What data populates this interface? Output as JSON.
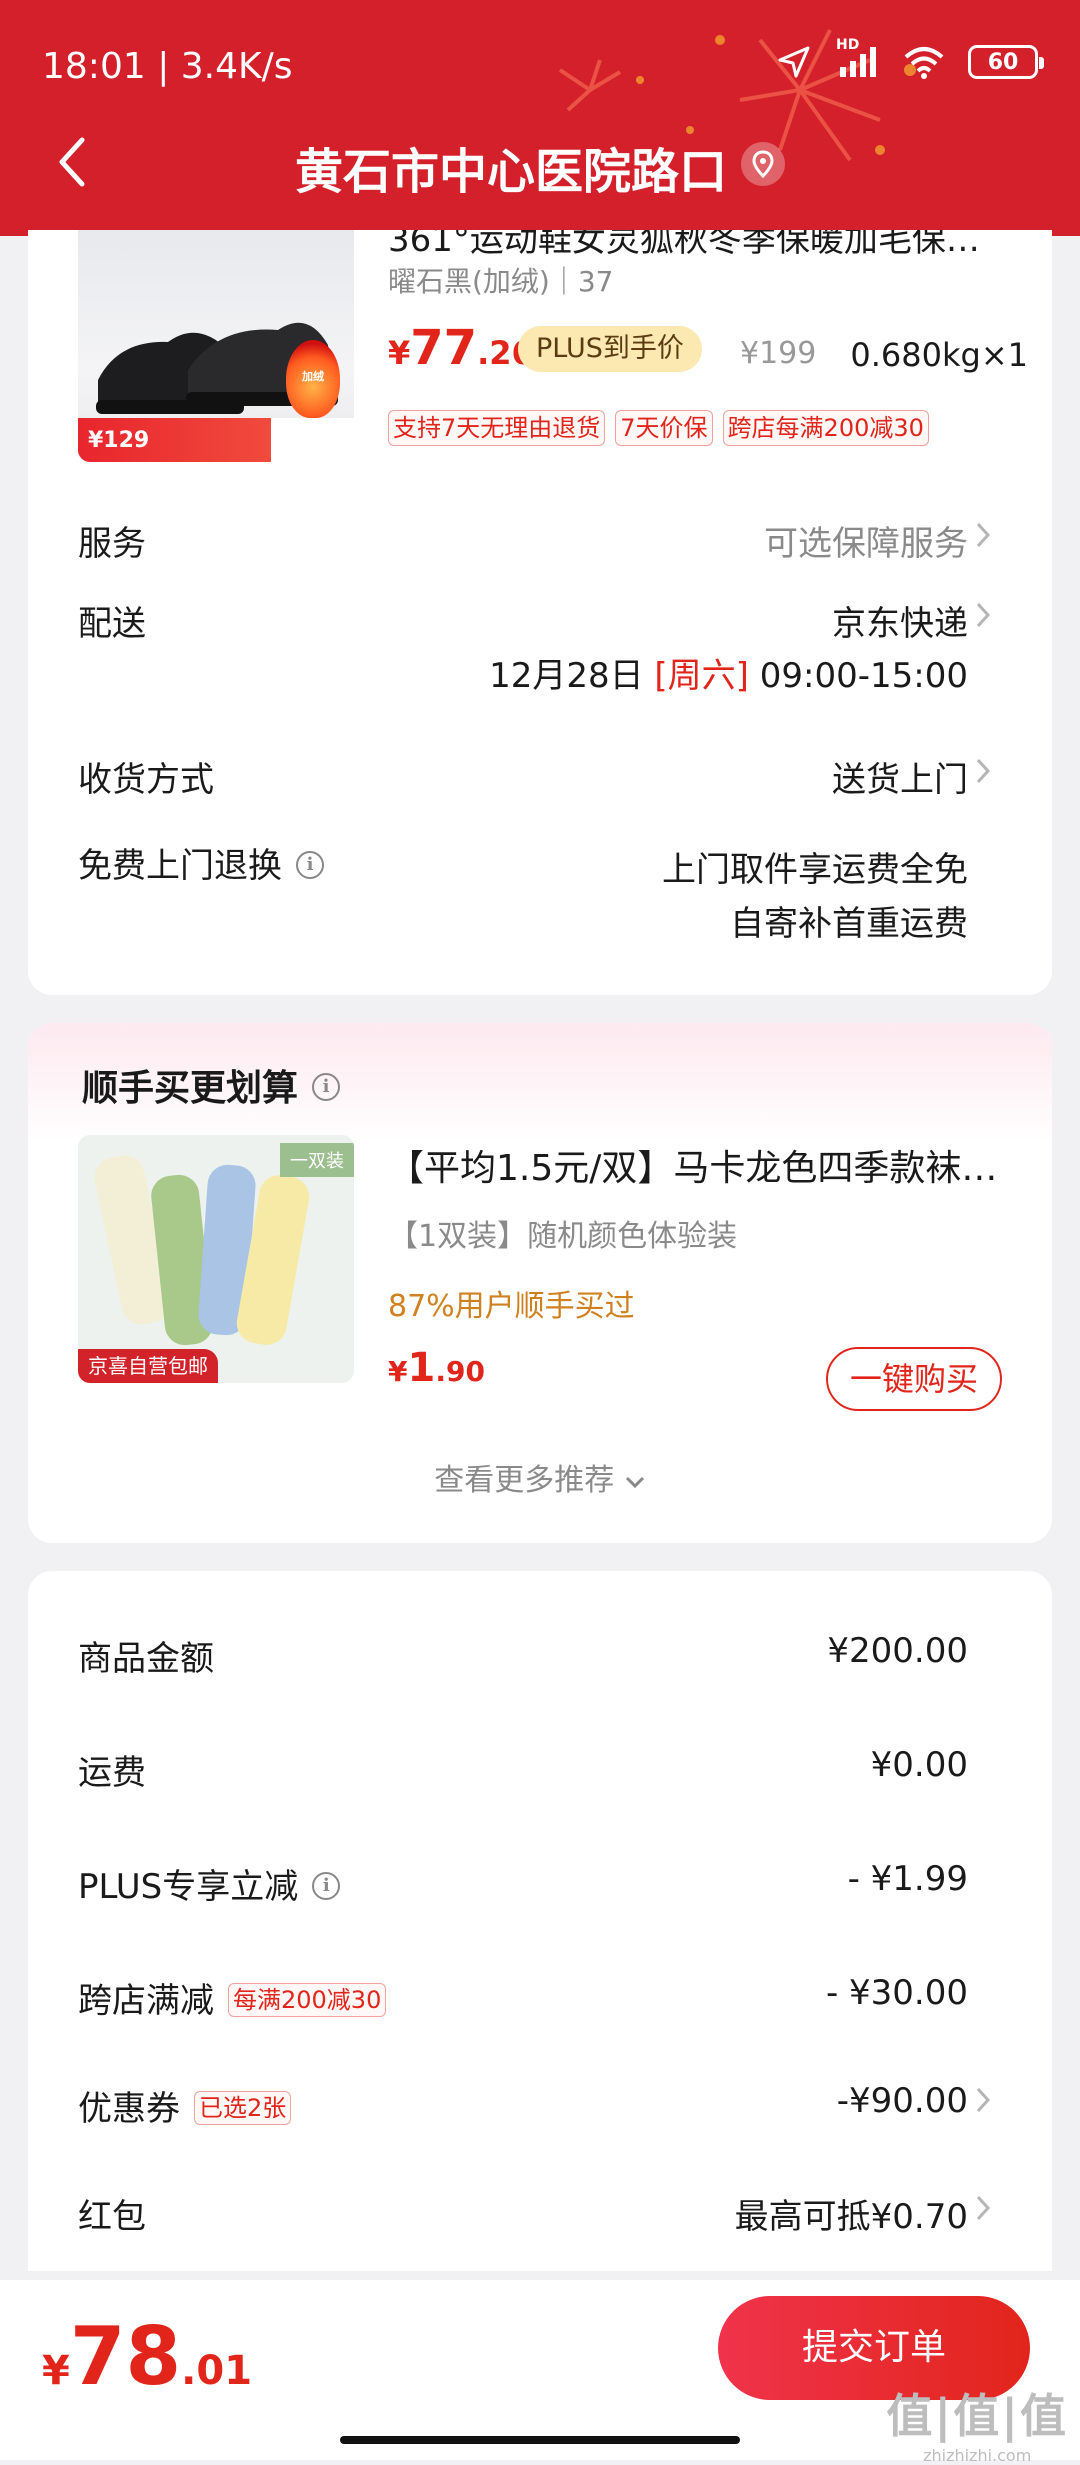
{
  "status_bar": {
    "time": "18:01 | 3.4K/s",
    "network": "HD",
    "battery": "60"
  },
  "header": {
    "title": "黄石市中心医院路口",
    "bg_color": "#d3202a"
  },
  "product": {
    "title": "361°运动鞋女灵狐秋冬季保暖加毛保暖…",
    "spec": "曜石黑(加绒)｜37",
    "price_symbol": "¥",
    "price_int": "77",
    "price_dec": ".26",
    "plus_label": "PLUS到手价",
    "original_price": "¥199",
    "weight_qty": "0.680kg×1",
    "tags": [
      "支持7天无理由退货",
      "7天价保",
      "跨店每满200减30"
    ],
    "image_banner": "¥129"
  },
  "rows": {
    "service": {
      "label": "服务",
      "value": "可选保障服务"
    },
    "delivery": {
      "label": "配送",
      "value": "京东快递",
      "date": "12月28日",
      "weekday": "[周六]",
      "time": "09:00-15:00"
    },
    "receive": {
      "label": "收货方式",
      "value": "送货上门"
    },
    "return": {
      "label": "免费上门退换",
      "line1": "上门取件享运费全免",
      "line2": "自寄补首重运费"
    }
  },
  "recommend": {
    "title": "顺手买更划算",
    "item_title": "【平均1.5元/双】马卡龙色四季款袜…",
    "item_sub": "【1双装】随机颜色体验装",
    "item_pct": "87%用户顺手买过",
    "price_symbol": "¥",
    "price_int": "1",
    "price_dec": ".90",
    "buy_label": "一键购买",
    "more_label": "查看更多推荐",
    "img_badge": "一双装",
    "img_label": "京喜自营包邮"
  },
  "summary": {
    "goods": {
      "label": "商品金额",
      "value": "¥200.00"
    },
    "shipping": {
      "label": "运费",
      "value": "¥0.00"
    },
    "plus": {
      "label": "PLUS专享立减",
      "value": "- ¥1.99"
    },
    "cross": {
      "label": "跨店满减",
      "tag": "每满200减30",
      "value": "- ¥30.00"
    },
    "coupon": {
      "label": "优惠券",
      "tag": "已选2张",
      "value": "-¥90.00"
    },
    "redpacket": {
      "label": "红包",
      "value": "最高可抵¥0.70"
    }
  },
  "footer": {
    "price_symbol": "¥",
    "price_int": "78",
    "price_dec": ".01",
    "submit_label": "提交订单",
    "watermark": "值|值|值",
    "watermark_sub": "zhizhizhi.com"
  },
  "colors": {
    "accent": "#e1251b",
    "plus_bg": "#fbe9b1",
    "pct_orange": "#d0811f"
  }
}
